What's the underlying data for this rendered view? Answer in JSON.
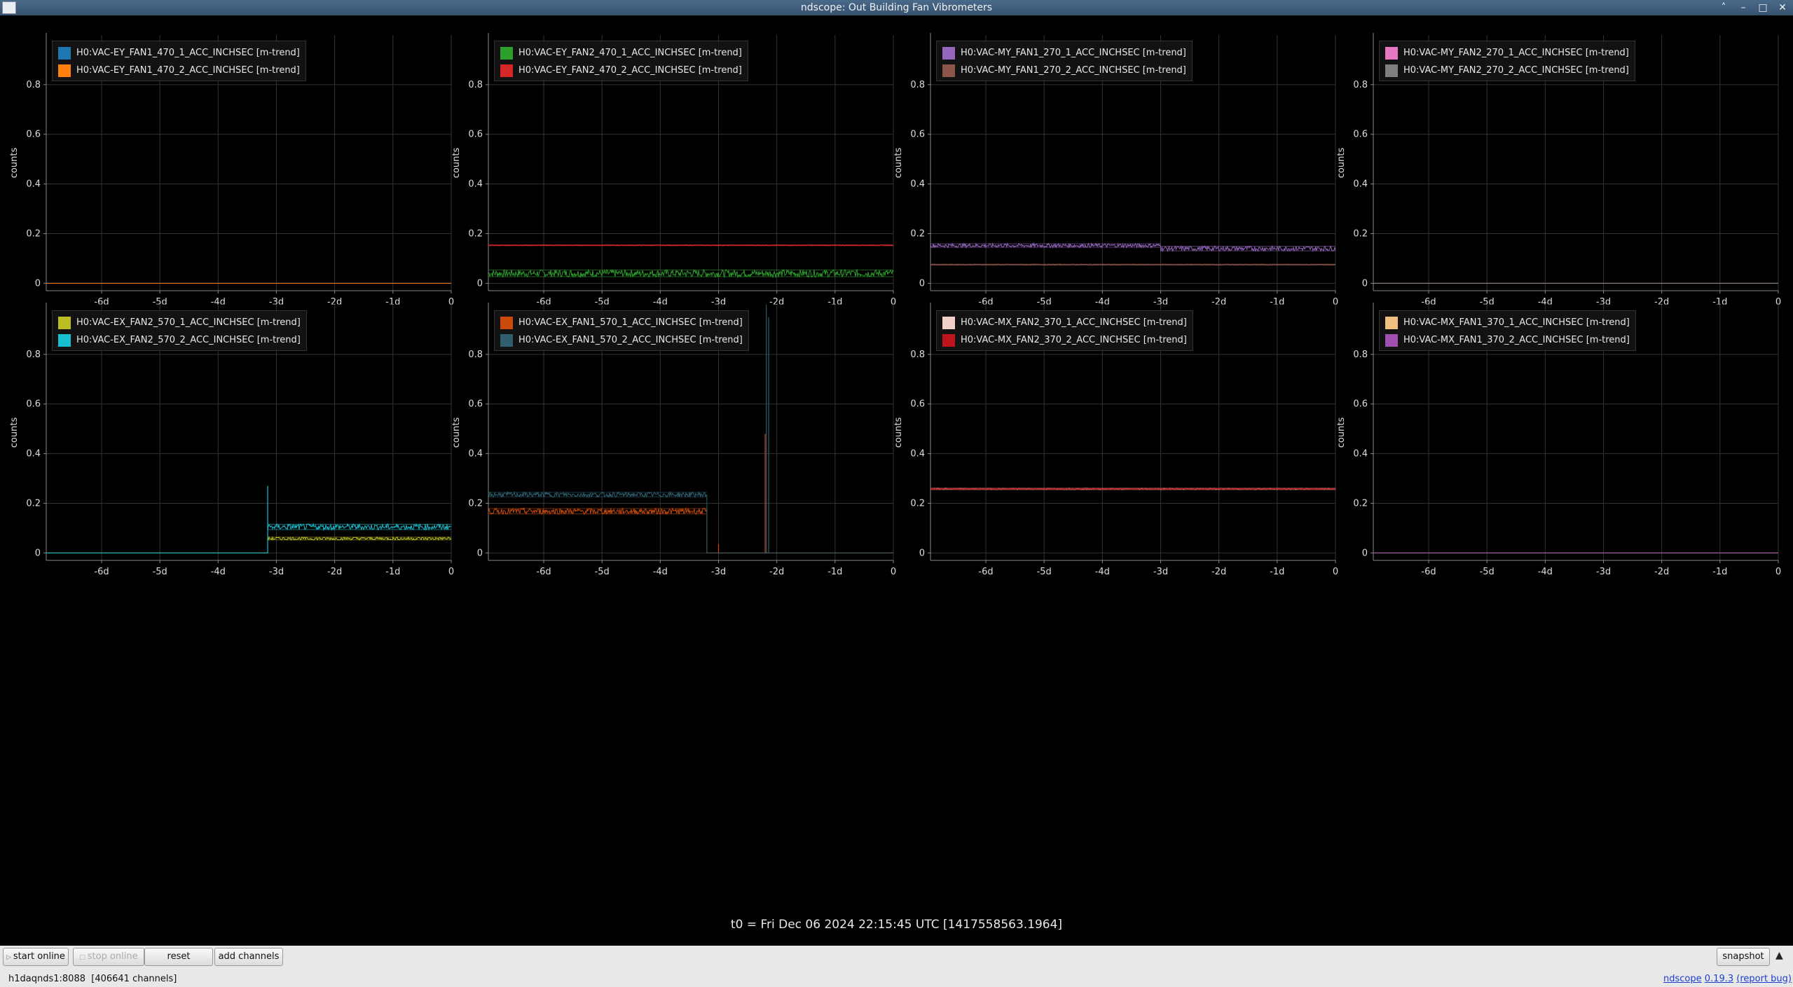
{
  "window": {
    "title": "ndscope: Out Building Fan Vibrometers"
  },
  "axes": {
    "ylabel": "counts",
    "yticks": [
      "0",
      "0.2",
      "0.4",
      "0.6",
      "0.8"
    ],
    "xticks": [
      "-6d",
      "-5d",
      "-4d",
      "-3d",
      "-2d",
      "-1d",
      "0"
    ],
    "ylim": [
      -0.03,
      1.0
    ],
    "xlim_days": [
      -6.95,
      0
    ]
  },
  "colors": {
    "background": "#000000",
    "grid": "#333333",
    "axis": "#888888"
  },
  "plots": [
    {
      "legend": [
        {
          "label": "H0:VAC-EY_FAN1_470_1_ACC_INCHSEC [m-trend]",
          "color": "#1f77b4"
        },
        {
          "label": "H0:VAC-EY_FAN1_470_2_ACC_INCHSEC [m-trend]",
          "color": "#ff7f0e"
        }
      ]
    },
    {
      "legend": [
        {
          "label": "H0:VAC-EY_FAN2_470_1_ACC_INCHSEC [m-trend]",
          "color": "#2ca02c"
        },
        {
          "label": "H0:VAC-EY_FAN2_470_2_ACC_INCHSEC [m-trend]",
          "color": "#d62728"
        }
      ]
    },
    {
      "legend": [
        {
          "label": "H0:VAC-MY_FAN1_270_1_ACC_INCHSEC [m-trend]",
          "color": "#9467bd"
        },
        {
          "label": "H0:VAC-MY_FAN1_270_2_ACC_INCHSEC [m-trend]",
          "color": "#8c564b"
        }
      ]
    },
    {
      "legend": [
        {
          "label": "H0:VAC-MY_FAN2_270_1_ACC_INCHSEC [m-trend]",
          "color": "#e377c2"
        },
        {
          "label": "H0:VAC-MY_FAN2_270_2_ACC_INCHSEC [m-trend]",
          "color": "#7f7f7f"
        }
      ]
    },
    {
      "legend": [
        {
          "label": "H0:VAC-EX_FAN2_570_1_ACC_INCHSEC [m-trend]",
          "color": "#bcbd22"
        },
        {
          "label": "H0:VAC-EX_FAN2_570_2_ACC_INCHSEC [m-trend]",
          "color": "#17becf"
        }
      ]
    },
    {
      "legend": [
        {
          "label": "H0:VAC-EX_FAN1_570_1_ACC_INCHSEC [m-trend]",
          "color": "#c94a0a"
        },
        {
          "label": "H0:VAC-EX_FAN1_570_2_ACC_INCHSEC [m-trend]",
          "color": "#2f5f6f"
        }
      ]
    },
    {
      "legend": [
        {
          "label": "H0:VAC-MX_FAN2_370_1_ACC_INCHSEC [m-trend]",
          "color": "#f0d0c8"
        },
        {
          "label": "H0:VAC-MX_FAN2_370_2_ACC_INCHSEC [m-trend]",
          "color": "#c0141c"
        }
      ]
    },
    {
      "legend": [
        {
          "label": "H0:VAC-MX_FAN1_370_1_ACC_INCHSEC [m-trend]",
          "color": "#f0c080"
        },
        {
          "label": "H0:VAC-MX_FAN1_370_2_ACC_INCHSEC [m-trend]",
          "color": "#a050b0"
        }
      ]
    }
  ],
  "chart_data": [
    {
      "type": "line",
      "ylabel": "counts",
      "series": [
        {
          "name": "H0:VAC-EY_FAN1_470_1_ACC_INCHSEC [m-trend]",
          "segments": [
            {
              "x0": -6.95,
              "x1": 0,
              "level": 0.0,
              "noise": 0.0
            }
          ]
        },
        {
          "name": "H0:VAC-EY_FAN1_470_2_ACC_INCHSEC [m-trend]",
          "segments": [
            {
              "x0": -6.95,
              "x1": 0,
              "level": 0.0,
              "noise": 0.0
            }
          ]
        }
      ]
    },
    {
      "type": "line",
      "ylabel": "counts",
      "series": [
        {
          "name": "H0:VAC-EY_FAN2_470_1_ACC_INCHSEC [m-trend]",
          "segments": [
            {
              "x0": -6.95,
              "x1": 0,
              "level": 0.04,
              "noise": 0.015
            }
          ]
        },
        {
          "name": "H0:VAC-EY_FAN2_470_2_ACC_INCHSEC [m-trend]",
          "segments": [
            {
              "x0": -6.95,
              "x1": 0,
              "level": 0.153,
              "noise": 0.002
            }
          ]
        }
      ]
    },
    {
      "type": "line",
      "ylabel": "counts",
      "series": [
        {
          "name": "H0:VAC-MY_FAN1_270_1_ACC_INCHSEC [m-trend]",
          "segments": [
            {
              "x0": -6.95,
              "x1": -3.0,
              "level": 0.152,
              "noise": 0.008
            },
            {
              "x0": -3.0,
              "x1": 0,
              "level": 0.14,
              "noise": 0.01
            }
          ]
        },
        {
          "name": "H0:VAC-MY_FAN1_270_2_ACC_INCHSEC [m-trend]",
          "segments": [
            {
              "x0": -6.95,
              "x1": 0,
              "level": 0.075,
              "noise": 0.002
            }
          ]
        }
      ]
    },
    {
      "type": "line",
      "ylabel": "counts",
      "series": [
        {
          "name": "H0:VAC-MY_FAN2_270_1_ACC_INCHSEC [m-trend]",
          "segments": [
            {
              "x0": -6.95,
              "x1": 0,
              "level": 0.0,
              "noise": 0.0
            }
          ]
        },
        {
          "name": "H0:VAC-MY_FAN2_270_2_ACC_INCHSEC [m-trend]",
          "segments": [
            {
              "x0": -6.95,
              "x1": 0,
              "level": 0.0,
              "noise": 0.0
            }
          ]
        }
      ]
    },
    {
      "type": "line",
      "ylabel": "counts",
      "series": [
        {
          "name": "H0:VAC-EX_FAN2_570_1_ACC_INCHSEC [m-trend]",
          "segments": [
            {
              "x0": -6.95,
              "x1": -3.15,
              "level": 0.0,
              "noise": 0.0
            },
            {
              "x0": -3.15,
              "x1": 0,
              "level": 0.058,
              "noise": 0.006
            }
          ]
        },
        {
          "name": "H0:VAC-EX_FAN2_570_2_ACC_INCHSEC [m-trend]",
          "segments": [
            {
              "x0": -6.95,
              "x1": -3.15,
              "level": 0.0,
              "noise": 0.0
            },
            {
              "x0": -3.15,
              "x1": 0,
              "level": 0.105,
              "noise": 0.012
            }
          ],
          "spikes": [
            {
              "x": -3.15,
              "y": 0.27
            }
          ]
        }
      ]
    },
    {
      "type": "line",
      "ylabel": "counts",
      "series": [
        {
          "name": "H0:VAC-EX_FAN1_570_1_ACC_INCHSEC [m-trend]",
          "segments": [
            {
              "x0": -6.95,
              "x1": -3.2,
              "level": 0.168,
              "noise": 0.012
            },
            {
              "x0": -3.2,
              "x1": 0,
              "level": 0.0,
              "noise": 0.0
            }
          ],
          "spikes": [
            {
              "x": -3.0,
              "y": 0.035
            },
            {
              "x": -2.2,
              "y": 0.48
            }
          ]
        },
        {
          "name": "H0:VAC-EX_FAN1_570_2_ACC_INCHSEC [m-trend]",
          "segments": [
            {
              "x0": -6.95,
              "x1": -3.2,
              "level": 0.235,
              "noise": 0.01
            },
            {
              "x0": -3.2,
              "x1": 0,
              "level": 0.0,
              "noise": 0.0
            }
          ],
          "spikes": [
            {
              "x": -2.18,
              "y": 1.0
            },
            {
              "x": -2.14,
              "y": 0.95
            }
          ]
        }
      ]
    },
    {
      "type": "line",
      "ylabel": "counts",
      "series": [
        {
          "name": "H0:VAC-MX_FAN2_370_1_ACC_INCHSEC [m-trend]",
          "segments": [
            {
              "x0": -6.95,
              "x1": 0,
              "level": 0.258,
              "noise": 0.003
            }
          ]
        },
        {
          "name": "H0:VAC-MX_FAN2_370_2_ACC_INCHSEC [m-trend]",
          "segments": [
            {
              "x0": -6.95,
              "x1": 0,
              "level": 0.258,
              "noise": 0.002
            }
          ]
        }
      ]
    },
    {
      "type": "line",
      "ylabel": "counts",
      "series": [
        {
          "name": "H0:VAC-MX_FAN1_370_1_ACC_INCHSEC [m-trend]",
          "segments": [
            {
              "x0": -6.95,
              "x1": 0,
              "level": 0.0,
              "noise": 0.0
            }
          ]
        },
        {
          "name": "H0:VAC-MX_FAN1_370_2_ACC_INCHSEC [m-trend]",
          "segments": [
            {
              "x0": -6.95,
              "x1": 0,
              "level": 0.0,
              "noise": 0.0
            }
          ]
        }
      ]
    }
  ],
  "t0_text": "t0 = Fri Dec 06 2024 22:15:45 UTC [1417558563.1964]",
  "toolbar": {
    "start_online": "start online",
    "stop_online": "stop online",
    "reset": "reset",
    "add_channels": "add channels",
    "snapshot": "snapshot",
    "expand_icon": "triangle-up-icon"
  },
  "status": {
    "server": "h1daqnds1:8088",
    "channels": "[406641 channels]",
    "app_name": "ndscope",
    "version": "0.19.3",
    "report_bug": "(report bug)"
  }
}
